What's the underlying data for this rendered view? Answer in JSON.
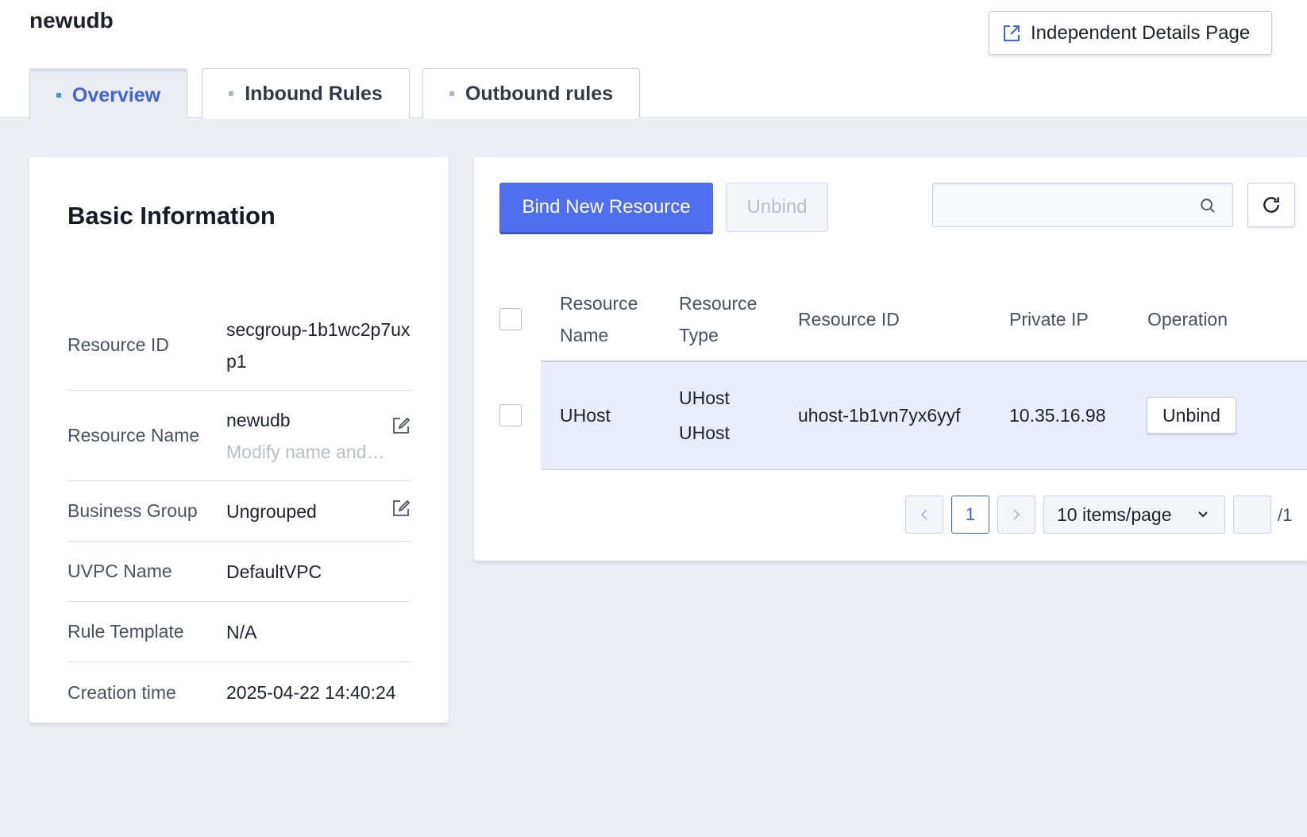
{
  "header": {
    "title": "newudb",
    "details_button_label": "Independent Details Page"
  },
  "tabs": [
    {
      "label": "Overview",
      "active": true
    },
    {
      "label": "Inbound Rules",
      "active": false
    },
    {
      "label": "Outbound rules",
      "active": false
    }
  ],
  "basic_info": {
    "title": "Basic Information",
    "rows": [
      {
        "label": "Resource ID",
        "value": "secgroup-1b1wc2p7uxp1"
      },
      {
        "label": "Resource Name",
        "value": "newudb",
        "sub": "Modify name and remark"
      },
      {
        "label": "Business Group",
        "value": "Ungrouped"
      },
      {
        "label": "UVPC Name",
        "value": "DefaultVPC"
      },
      {
        "label": "Rule Template",
        "value": "N/A"
      },
      {
        "label": "Creation time",
        "value": "2025-04-22 14:40:24"
      }
    ]
  },
  "resources": {
    "bind_button_label": "Bind New Resource",
    "unbind_button_label": "Unbind",
    "search_placeholder": "",
    "columns": [
      "Resource Name",
      "Resource Type",
      "Resource ID",
      "Private IP",
      "Operation"
    ],
    "rows": [
      {
        "name": "UHost",
        "type_line1": "UHost",
        "type_line2": "UHost",
        "id": "uhost-1b1vn7yx6yyf",
        "private_ip": "10.35.16.98",
        "operation_label": "Unbind"
      }
    ]
  },
  "pagination": {
    "current_page": "1",
    "page_size_label": "10 items/page",
    "total_pages_label": "/1"
  },
  "colors": {
    "accent": "#4f6ef0",
    "active_tab_text": "#3d63e0",
    "background": "#eceef5",
    "selected_row": "#e8ecfb"
  },
  "icons": {
    "details": "external-link-icon",
    "edit": "edit-icon",
    "search": "search-icon",
    "refresh": "refresh-icon",
    "prev": "chevron-left-icon",
    "next": "chevron-right-icon",
    "dropdown": "chevron-down-icon"
  }
}
